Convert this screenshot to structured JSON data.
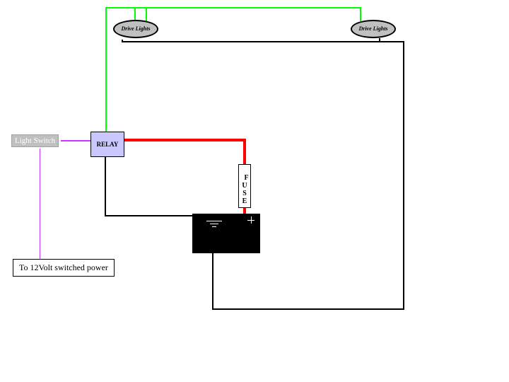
{
  "components": {
    "drive_light_left": {
      "label": "Drive Lights"
    },
    "drive_light_right": {
      "label": "Drive Lights"
    },
    "relay": {
      "label": "RELAY"
    },
    "light_switch": {
      "label": "Light Switch"
    },
    "fuse": {
      "label": "F\nU\nS\nE"
    },
    "label_12v": {
      "text": "To 12Volt switched power"
    }
  },
  "wires": {
    "colors": {
      "green": "#00ff00",
      "red": "#ff0000",
      "purple": "#cc33ff",
      "black": "#000000"
    }
  }
}
